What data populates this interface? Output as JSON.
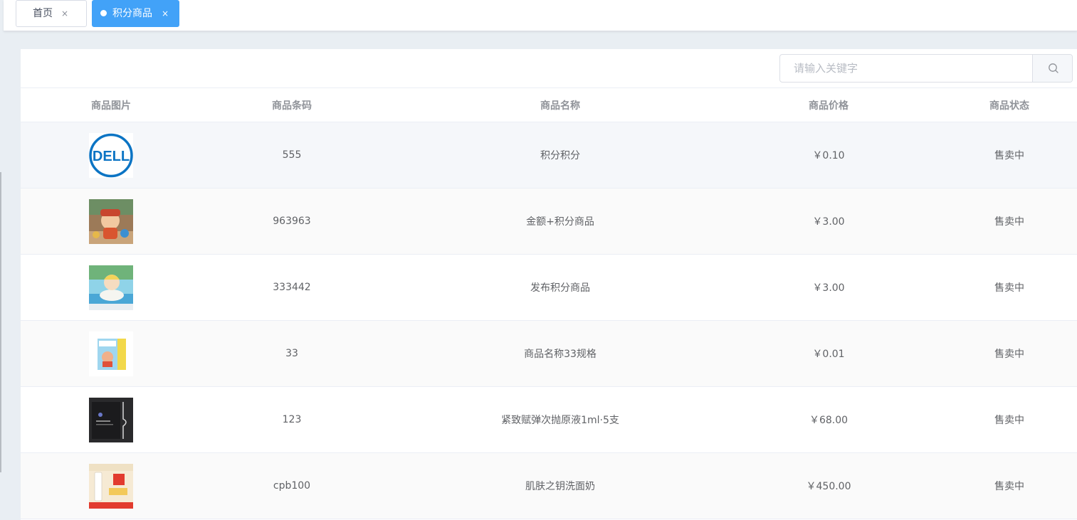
{
  "tabs": [
    {
      "label": "首页",
      "close": "×",
      "active": false
    },
    {
      "label": "积分商品",
      "close": "×",
      "active": true
    }
  ],
  "search": {
    "placeholder": "请输入关键字",
    "value": ""
  },
  "table": {
    "headers": [
      "商品图片",
      "商品条码",
      "商品名称",
      "商品价格",
      "商品状态"
    ],
    "rows": [
      {
        "barcode": "555",
        "name": "积分积分",
        "price": "￥0.10",
        "status": "售卖中",
        "image": "dell-logo"
      },
      {
        "barcode": "963963",
        "name": "金额+积分商品",
        "price": "￥3.00",
        "status": "售卖中",
        "image": "toy-figure-photo"
      },
      {
        "barcode": "333442",
        "name": "发布积分商品",
        "price": "￥3.00",
        "status": "售卖中",
        "image": "pool-figure-photo"
      },
      {
        "barcode": "33",
        "name": "商品名称33规格",
        "price": "￥0.01",
        "status": "售卖中",
        "image": "toy-box-photo"
      },
      {
        "barcode": "123",
        "name": "紧致赋弹次抛原液1ml·5支",
        "price": "￥68.00",
        "status": "售卖中",
        "image": "black-box-photo"
      },
      {
        "barcode": "cpb100",
        "name": "肌肤之钥洗面奶",
        "price": "￥450.00",
        "status": "售卖中",
        "image": "cleanser-promo-photo"
      }
    ]
  },
  "colors": {
    "accent": "#42a2f8",
    "header_text": "#909399",
    "body_text": "#606266"
  }
}
